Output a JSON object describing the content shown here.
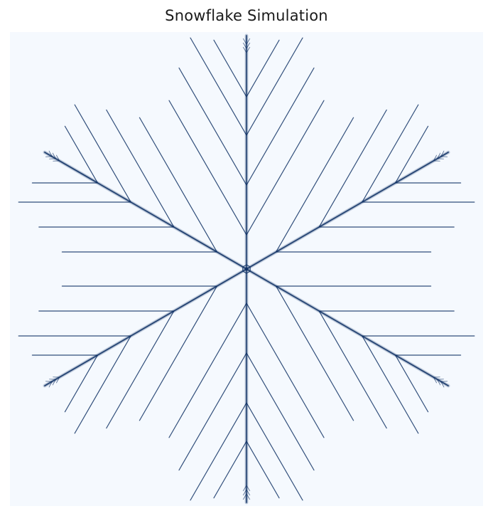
{
  "figure": {
    "title": "Snowflake Simulation"
  },
  "image": {
    "subject": "snowflake",
    "background_color": "#f5f9fe",
    "crystal_color": "#0d2f63",
    "symmetry": "six-fold",
    "arms": 6,
    "side_branches_per_side": 4
  }
}
